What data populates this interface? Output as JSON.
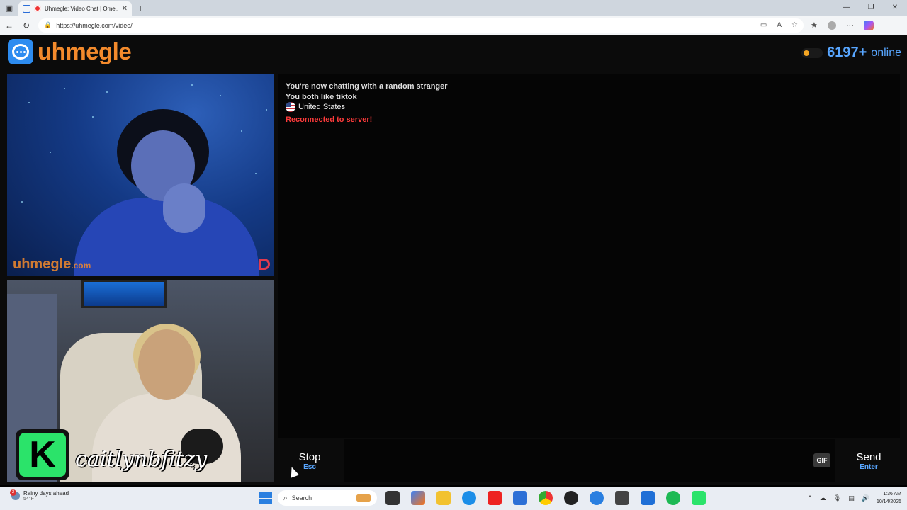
{
  "browser": {
    "tab_title": "Uhmegle: Video Chat | Ome...",
    "url": "https://uhmegle.com/video/"
  },
  "site": {
    "logo_text": "uhmegle",
    "online_count": "6197+",
    "online_label": "online"
  },
  "video": {
    "watermark": "uhmegle",
    "watermark_suffix": ".com",
    "self_badge_letter": "K",
    "self_handle": "caitlynbfitzy"
  },
  "chat": {
    "line1": "You're now chatting with a random stranger",
    "line2": "You both like tiktok",
    "country": "United States",
    "status": "Reconnected to server!"
  },
  "controls": {
    "stop_label": "Stop",
    "stop_key": "Esc",
    "gif_label": "GIF",
    "send_label": "Send",
    "send_key": "Enter"
  },
  "taskbar": {
    "weather_badge": "2",
    "weather_title": "Rainy days ahead",
    "weather_temp": "54°F",
    "search_placeholder": "Search",
    "time": "1:36 AM",
    "date": "10/14/2025"
  },
  "colors": {
    "brand_orange": "#f38a2c",
    "accent_blue": "#58a6ff",
    "error_red": "#ff3b3b"
  }
}
